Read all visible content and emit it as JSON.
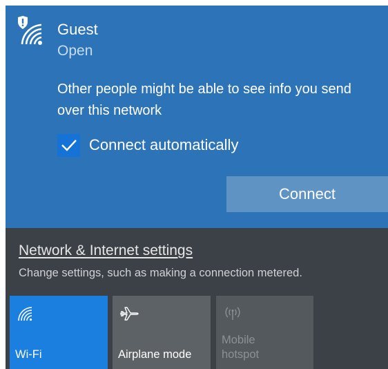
{
  "network": {
    "ssid": "Guest",
    "security": "Open",
    "warning": "Other people might be able to see info you send over this network",
    "auto_connect_label": "Connect automatically",
    "auto_connect_checked": true,
    "connect_label": "Connect",
    "icon": "wifi-shield-icon"
  },
  "settings": {
    "link_label": "Network & Internet settings",
    "description": "Change settings, such as making a connection metered."
  },
  "quick_actions": [
    {
      "label": "Wi-Fi",
      "icon": "wifi-icon",
      "active": true
    },
    {
      "label": "Airplane mode",
      "icon": "airplane-icon",
      "active": false
    },
    {
      "label": "Mobile hotspot",
      "icon": "hotspot-icon",
      "active": false,
      "disabled": true
    }
  ],
  "colors": {
    "panel": "#2d73b8",
    "accent": "#1a7fde",
    "checkbox": "#1572d6",
    "connect_button": "#5f93c4",
    "background": "#3c4147"
  }
}
